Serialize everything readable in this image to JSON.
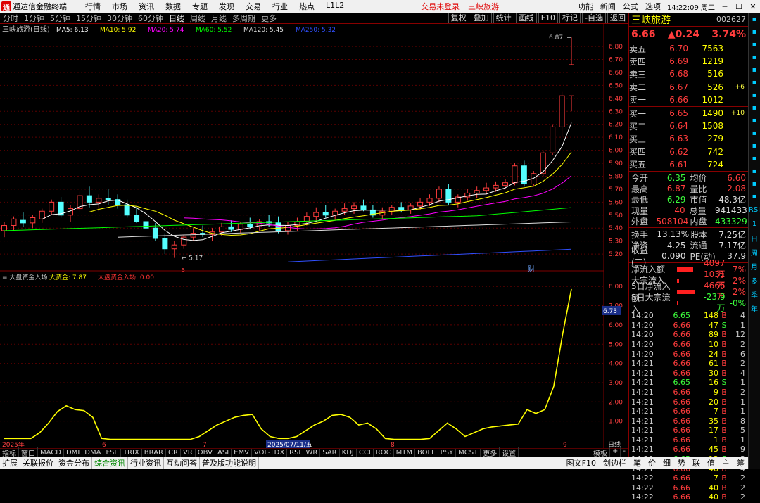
{
  "menubar": {
    "app_title": "通达信金融终端",
    "menus": [
      "行情",
      "市场",
      "资讯",
      "数据",
      "专题",
      "发现",
      "交易",
      "行业",
      "热点",
      "L1L2"
    ],
    "trade_status": "交易未登录",
    "stock_link": "三峡旅游",
    "right_menus": [
      "功能",
      "新闻",
      "公式",
      "选项"
    ],
    "clock": "14:22:09 周二"
  },
  "tabbar": {
    "periods": [
      "分时",
      "1分钟",
      "5分钟",
      "15分钟",
      "30分钟",
      "60分钟",
      "日线",
      "周线",
      "月线",
      "多周期",
      "更多"
    ],
    "active": "日线",
    "buttons": [
      "复权",
      "叠加",
      "统计",
      "画线",
      "F10",
      "标记",
      "-自选",
      "返回"
    ]
  },
  "chart": {
    "header": "三峡旅游(日线)",
    "ma": [
      {
        "label": "MA5: 6.13",
        "color": "#ffffff"
      },
      {
        "label": "MA10: 5.92",
        "color": "#ffff00"
      },
      {
        "label": "MA20: 5.74",
        "color": "#ff00ff"
      },
      {
        "label": "MA60: 5.52",
        "color": "#00ff00"
      },
      {
        "label": "MA120: 5.45",
        "color": "#dddddd"
      },
      {
        "label": "MA250: 5.32",
        "color": "#3050ff"
      }
    ],
    "high_label": "6.87",
    "low_label": "5.17",
    "event_s": "s",
    "event_cai": "财",
    "sub_header": "大盘资金入场",
    "sub_labels": [
      {
        "label": "大资金: 7.87",
        "color": "#ffff00"
      },
      {
        "label": "大盘资金入场: 0.00",
        "color": "#ff3333"
      }
    ],
    "sub_cursor": "6.73",
    "x_labels": [
      "2025年",
      "6",
      "7",
      "2025/07/11/五",
      "8",
      "9"
    ],
    "period_label": "日线"
  },
  "chart_data": [
    {
      "type": "candlestick",
      "title": "三峡旅游(日线)",
      "yticks": [
        "5.20",
        "5.30",
        "5.40",
        "5.50",
        "5.60",
        "5.70",
        "5.80",
        "5.90",
        "6.00",
        "6.10",
        "6.20",
        "6.30",
        "6.40",
        "6.50",
        "6.60",
        "6.70",
        "6.80"
      ],
      "ylim": [
        5.13,
        6.92
      ],
      "ohlc": [
        [
          5.38,
          5.45,
          5.33,
          5.42
        ],
        [
          5.42,
          5.49,
          5.38,
          5.47
        ],
        [
          5.46,
          5.52,
          5.41,
          5.44
        ],
        [
          5.44,
          5.5,
          5.4,
          5.48
        ],
        [
          5.47,
          5.55,
          5.44,
          5.53
        ],
        [
          5.53,
          5.62,
          5.5,
          5.6
        ],
        [
          5.6,
          5.64,
          5.48,
          5.5
        ],
        [
          5.5,
          5.58,
          5.45,
          5.55
        ],
        [
          5.55,
          5.68,
          5.52,
          5.65
        ],
        [
          5.65,
          5.72,
          5.56,
          5.6
        ],
        [
          5.6,
          5.66,
          5.53,
          5.63
        ],
        [
          5.63,
          5.7,
          5.58,
          5.62
        ],
        [
          5.62,
          5.66,
          5.55,
          5.58
        ],
        [
          5.58,
          5.62,
          5.48,
          5.5
        ],
        [
          5.5,
          5.56,
          5.44,
          5.45
        ],
        [
          5.45,
          5.5,
          5.38,
          5.4
        ],
        [
          5.4,
          5.44,
          5.3,
          5.32
        ],
        [
          5.32,
          5.36,
          5.2,
          5.24
        ],
        [
          5.24,
          5.3,
          5.17,
          5.27
        ],
        [
          5.27,
          5.35,
          5.24,
          5.33
        ],
        [
          5.33,
          5.4,
          5.3,
          5.36
        ],
        [
          5.36,
          5.42,
          5.33,
          5.35
        ],
        [
          5.35,
          5.4,
          5.3,
          5.37
        ],
        [
          5.37,
          5.44,
          5.34,
          5.41
        ],
        [
          5.41,
          5.46,
          5.37,
          5.39
        ],
        [
          5.39,
          5.45,
          5.36,
          5.43
        ],
        [
          5.43,
          5.48,
          5.39,
          5.41
        ],
        [
          5.41,
          5.47,
          5.38,
          5.45
        ],
        [
          5.45,
          5.5,
          5.41,
          5.44
        ],
        [
          5.44,
          5.49,
          5.36,
          5.38
        ],
        [
          5.38,
          5.45,
          5.35,
          5.42
        ],
        [
          5.42,
          5.48,
          5.38,
          5.45
        ],
        [
          5.45,
          5.52,
          5.42,
          5.49
        ],
        [
          5.49,
          5.56,
          5.45,
          5.52
        ],
        [
          5.52,
          5.58,
          5.48,
          5.5
        ],
        [
          5.5,
          5.55,
          5.46,
          5.53
        ],
        [
          5.53,
          5.59,
          5.5,
          5.55
        ],
        [
          5.55,
          5.6,
          5.51,
          5.57
        ],
        [
          5.57,
          5.62,
          5.53,
          5.54
        ],
        [
          5.54,
          5.58,
          5.48,
          5.5
        ],
        [
          5.5,
          5.56,
          5.47,
          5.53
        ],
        [
          5.53,
          5.58,
          5.5,
          5.56
        ],
        [
          5.56,
          5.6,
          5.52,
          5.54
        ],
        [
          5.54,
          5.59,
          5.51,
          5.57
        ],
        [
          5.57,
          5.63,
          5.54,
          5.6
        ],
        [
          5.6,
          5.66,
          5.57,
          5.63
        ],
        [
          5.63,
          5.72,
          5.6,
          5.7
        ],
        [
          5.7,
          5.74,
          5.58,
          5.6
        ],
        [
          5.6,
          5.66,
          5.56,
          5.64
        ],
        [
          5.64,
          5.7,
          5.61,
          5.67
        ],
        [
          5.67,
          5.72,
          5.63,
          5.69
        ],
        [
          5.69,
          5.75,
          5.66,
          5.71
        ],
        [
          5.71,
          5.76,
          5.68,
          5.73
        ],
        [
          5.73,
          5.78,
          5.7,
          5.75
        ],
        [
          5.75,
          5.9,
          5.73,
          5.88
        ],
        [
          5.88,
          5.92,
          5.72,
          5.74
        ],
        [
          5.74,
          5.84,
          5.72,
          5.82
        ],
        [
          5.82,
          6.0,
          5.8,
          5.98
        ],
        [
          5.98,
          6.2,
          5.96,
          6.18
        ],
        [
          6.18,
          6.45,
          6.1,
          6.42
        ],
        [
          6.42,
          6.87,
          6.3,
          6.66
        ]
      ],
      "ma_values": {
        "MA5": 6.13,
        "MA10": 5.92,
        "MA20": 5.74,
        "MA60": 5.52,
        "MA120": 5.45,
        "MA250": 5.32
      }
    },
    {
      "type": "line",
      "title": "大盘资金入场",
      "yticks": [
        "1.00",
        "2.00",
        "3.00",
        "4.00",
        "5.00",
        "6.00",
        "7.00",
        "8.00"
      ],
      "ylim": [
        0,
        8.3
      ],
      "series": [
        {
          "name": "大资金",
          "values": [
            0.1,
            0.1,
            0.1,
            0.1,
            0.4,
            0.9,
            1.5,
            1.8,
            1.6,
            1.55,
            1.2,
            0.1,
            0.05,
            0.05,
            0.05,
            0.05,
            0.05,
            0.05,
            0.05,
            0.05,
            0.05,
            0.05,
            0.2,
            0.5,
            0.8,
            1.0,
            1.2,
            1.3,
            1.35,
            0.6,
            0.2,
            0.1,
            0.1,
            0.2,
            0.5,
            0.8,
            1.0,
            1.3,
            1.35,
            1.2,
            0.8,
            0.9,
            0.6,
            0.1,
            0.05,
            0.05,
            0.05,
            0.05,
            0.1,
            0.5,
            0.9,
            0.6,
            0.2,
            0.4,
            0.6,
            0.7,
            0.75,
            0.8,
            0.85,
            1.6,
            1.4,
            1.6,
            2.8,
            5.5,
            7.87
          ]
        }
      ]
    }
  ],
  "quote": {
    "name": "三峡旅游",
    "code": "002627",
    "price": "6.66",
    "change": "▲0.24",
    "pct": "3.74%",
    "asks": [
      {
        "label": "卖五",
        "price": "6.70",
        "vol": "7563",
        "chg": ""
      },
      {
        "label": "卖四",
        "price": "6.69",
        "vol": "1219",
        "chg": ""
      },
      {
        "label": "卖三",
        "price": "6.68",
        "vol": "516",
        "chg": ""
      },
      {
        "label": "卖二",
        "price": "6.67",
        "vol": "526",
        "chg": "+6"
      },
      {
        "label": "卖一",
        "price": "6.66",
        "vol": "1012",
        "chg": ""
      }
    ],
    "bids": [
      {
        "label": "买一",
        "price": "6.65",
        "vol": "1490",
        "chg": "+10"
      },
      {
        "label": "买二",
        "price": "6.64",
        "vol": "1508",
        "chg": ""
      },
      {
        "label": "买三",
        "price": "6.63",
        "vol": "279",
        "chg": ""
      },
      {
        "label": "买四",
        "price": "6.62",
        "vol": "742",
        "chg": ""
      },
      {
        "label": "买五",
        "price": "6.61",
        "vol": "724",
        "chg": ""
      }
    ],
    "stats": [
      {
        "k": "今开",
        "v": "6.35",
        "c": "dn",
        "k2": "均价",
        "v2": "6.60",
        "c2": "up"
      },
      {
        "k": "最高",
        "v": "6.87",
        "c": "up",
        "k2": "量比",
        "v2": "2.08",
        "c2": "up"
      },
      {
        "k": "最低",
        "v": "6.29",
        "c": "dn",
        "k2": "市值",
        "v2": "48.3亿",
        "c2": "flat"
      },
      {
        "k": "现量",
        "v": "40",
        "c": "up",
        "k2": "总量",
        "v2": "941433",
        "c2": "flat"
      },
      {
        "k": "外盘",
        "v": "508104",
        "c": "up",
        "k2": "内盘",
        "v2": "433329",
        "c2": "dn"
      }
    ],
    "stats2": [
      {
        "k": "换手",
        "v": "13.13%",
        "c": "flat",
        "k2": "股本",
        "v2": "7.25亿",
        "c2": "flat"
      },
      {
        "k": "净资",
        "v": "4.25",
        "c": "flat",
        "k2": "流通",
        "v2": "7.17亿",
        "c2": "flat"
      },
      {
        "k": "收益(三)",
        "v": "0.090",
        "c": "flat",
        "k2": "PE(动)",
        "v2": "37.9",
        "c2": "flat"
      }
    ],
    "flows": [
      {
        "k": "净流入额",
        "bar": 0.8,
        "v": "4097万",
        "p": "7%"
      },
      {
        "k": "大宗流入",
        "bar": 0.12,
        "v": "1031万",
        "p": "2%"
      },
      {
        "k": "5日净流入额",
        "bar": 0.9,
        "v": "4666万",
        "p": "2%"
      },
      {
        "k": "5日大宗流入",
        "bar": 0.02,
        "v": "-23.9万",
        "p": "-0%"
      }
    ],
    "ticks": [
      [
        "14:20",
        "6.65",
        "148",
        "B",
        "4"
      ],
      [
        "14:20",
        "6.66",
        "47",
        "S",
        "1"
      ],
      [
        "14:20",
        "6.66",
        "89",
        "B",
        "12"
      ],
      [
        "14:20",
        "6.66",
        "10",
        "B",
        "2"
      ],
      [
        "14:20",
        "6.66",
        "24",
        "B",
        "6"
      ],
      [
        "14:21",
        "6.66",
        "61",
        "B",
        "2"
      ],
      [
        "14:21",
        "6.66",
        "30",
        "B",
        "4"
      ],
      [
        "14:21",
        "6.65",
        "16",
        "S",
        "1"
      ],
      [
        "14:21",
        "6.66",
        "9",
        "B",
        "2"
      ],
      [
        "14:21",
        "6.66",
        "20",
        "B",
        "1"
      ],
      [
        "14:21",
        "6.66",
        "7",
        "B",
        "1"
      ],
      [
        "14:21",
        "6.66",
        "35",
        "B",
        "8"
      ],
      [
        "14:21",
        "6.66",
        "17",
        "B",
        "5"
      ],
      [
        "14:21",
        "6.66",
        "1",
        "B",
        "1"
      ],
      [
        "14:21",
        "6.66",
        "45",
        "B",
        "9"
      ],
      [
        "14:21",
        "6.65",
        "12",
        "S",
        "3"
      ],
      [
        "14:21",
        "6.66",
        "40",
        "B",
        "4"
      ],
      [
        "14:22",
        "6.66",
        "7",
        "B",
        "2"
      ],
      [
        "14:22",
        "6.66",
        "40",
        "B",
        "2"
      ],
      [
        "14:22",
        "6.66",
        "40",
        "B",
        "2"
      ]
    ]
  },
  "indbar": [
    "指标",
    "窗口",
    "MACD",
    "DMI",
    "DMA",
    "FSL",
    "TRIX",
    "BRAR",
    "CR",
    "VR",
    "OBV",
    "ASI",
    "EMV",
    "VOL-TDX",
    "RSI",
    "WR",
    "SAR",
    "KDJ",
    "CCI",
    "ROC",
    "MTM",
    "BOLL",
    "PSY",
    "MCST",
    "更多",
    "设置"
  ],
  "indbar_right": [
    "模板",
    "+",
    "-"
  ],
  "statusbar": [
    "扩展",
    "关联报价",
    "资金分布",
    "综合资讯",
    "行业资讯",
    "互动问答",
    "普及版功能说明"
  ],
  "statusbar_right": [
    "图文F10",
    "剑边栏",
    "笔",
    "价",
    "细",
    "势",
    "联",
    "值",
    "主",
    "筹"
  ],
  "rightbar": [
    "RSI",
    "1",
    "日",
    "周",
    "月",
    "多",
    "季",
    "年"
  ]
}
